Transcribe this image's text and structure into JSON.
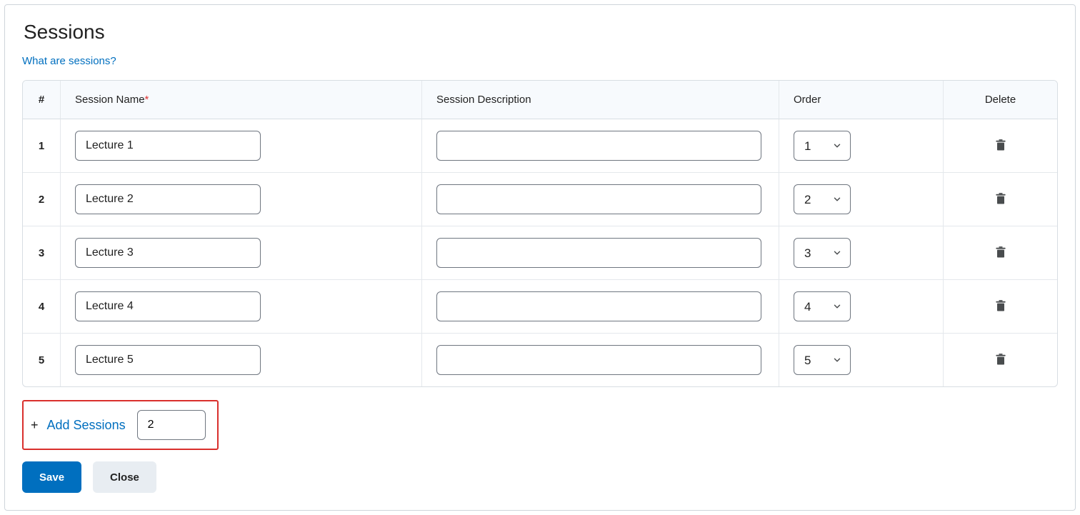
{
  "title": "Sessions",
  "help_link": "What are sessions?",
  "columns": {
    "num": "#",
    "name": "Session Name",
    "name_required_mark": "*",
    "desc": "Session Description",
    "order": "Order",
    "delete": "Delete"
  },
  "rows": [
    {
      "num": "1",
      "name": "Lecture 1",
      "desc": "",
      "order": "1"
    },
    {
      "num": "2",
      "name": "Lecture 2",
      "desc": "",
      "order": "2"
    },
    {
      "num": "3",
      "name": "Lecture 3",
      "desc": "",
      "order": "3"
    },
    {
      "num": "4",
      "name": "Lecture 4",
      "desc": "",
      "order": "4"
    },
    {
      "num": "5",
      "name": "Lecture 5",
      "desc": "",
      "order": "5"
    }
  ],
  "add_sessions": {
    "label": "Add Sessions",
    "count": "2"
  },
  "buttons": {
    "save": "Save",
    "close": "Close"
  }
}
